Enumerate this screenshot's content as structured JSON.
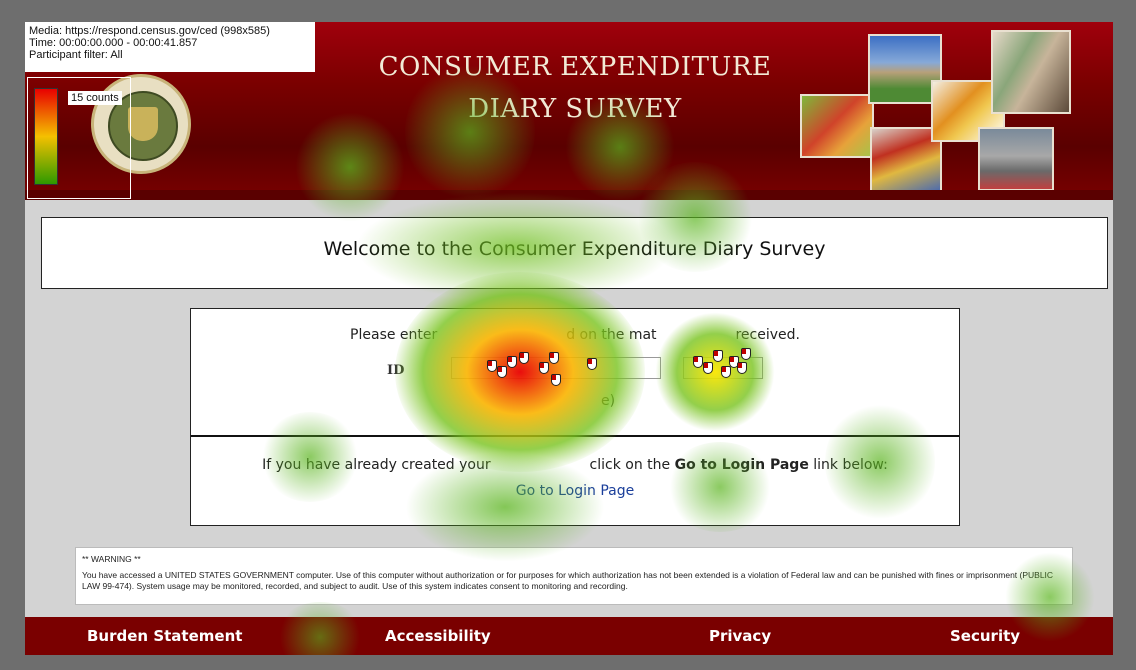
{
  "meta": {
    "media": "Media: https://respond.census.gov/ced (998x585)",
    "time": "Time: 00:00:00.000 - 00:00:41.857",
    "participant": "Participant filter: All",
    "counts": "15 counts"
  },
  "header": {
    "title_line1": "CONSUMER EXPENDITURE",
    "title_line2": "DIARY SURVEY"
  },
  "welcome": "Welcome to the Consumer Expenditure Diary Survey",
  "login": {
    "instruction_left": "Please enter",
    "instruction_mid": "d on the mat",
    "instruction_right": "received.",
    "id_label": "ID",
    "note": "e)",
    "already_prefix": "If you have already created your",
    "already_mid": "click on the",
    "already_bold": "Go to Login Page",
    "already_suffix": "link below:",
    "link_text": "Go to Login Page"
  },
  "warning": {
    "heading": "** WARNING **",
    "body": "You have accessed a UNITED STATES GOVERNMENT computer. Use of this computer without authorization or for purposes for which authorization has not been extended is a violation of Federal law and can be punished with fines or imprisonment (PUBLIC LAW 99-474). System usage may be monitored, recorded, and subject to audit. Use of this system indicates consent to monitoring and recording."
  },
  "footer": {
    "burden": "Burden Statement",
    "accessibility": "Accessibility",
    "privacy": "Privacy",
    "security": "Security"
  },
  "colors": {
    "header_red": "#7a0000",
    "link_blue": "#1a3e9a",
    "heat_green": "#4caf1a",
    "heat_red": "#e80000"
  }
}
